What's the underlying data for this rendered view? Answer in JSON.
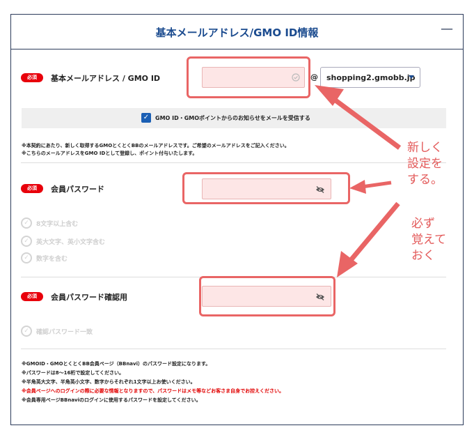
{
  "header": {
    "title": "基本メールアドレス/GMO ID情報",
    "collapse_symbol": "—"
  },
  "required_badge": "必須",
  "email": {
    "label": "基本メールアドレス / GMO ID",
    "value": "",
    "at": "@",
    "domain_selected": "shopping2.gmobb.jp"
  },
  "consent": {
    "checked": true,
    "label": "GMO ID・GMOポイントからのお知らせをメールを受信する"
  },
  "notes_email": [
    "※本契約にあたり、新しく取得するGMOとくとくBBのメールアドレスです。ご希望のメールアドレスをご記入ください。",
    "※こちらのメールアドレスをGMO IDとして登録し、ポイント付与いたします。"
  ],
  "password": {
    "label": "会員パスワード",
    "value": "",
    "rules": [
      "8文字以上含む",
      "英大文字、英小文字含む",
      "数字を含む"
    ]
  },
  "password_confirm": {
    "label": "会員パスワード確認用",
    "value": "",
    "rule": "確認パスワード一致"
  },
  "notes_password": [
    "※GMOID・GMOとくとくBB会員ページ（BBnavi）のパスワード設定になります。",
    "※パスワードは8～16桁で設定してください。",
    "※半角英大文字、半角英小文字、数字からそれぞれ1文字以上お使いください。",
    "※会員ページへのログインの際に必要な情報となりますので、パスワードはメモ等などお客さま自身でお控えください。",
    "※会員専用ページBBnaviのログインに使用するパスワードを設定してください。"
  ],
  "annotations": {
    "set_new": [
      "新しく",
      "設定を",
      "する。"
    ],
    "remember": [
      "必ず",
      "覚えて",
      "おく"
    ]
  },
  "colors": {
    "accent": "#1b4b8f",
    "required": "#e8000b",
    "highlight": "#e96565",
    "warning": "#e10000"
  }
}
